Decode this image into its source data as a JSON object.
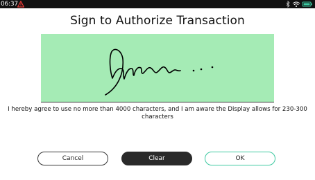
{
  "status_bar": {
    "time": "06:37",
    "icons": [
      "warning-icon",
      "bluetooth-icon",
      "wifi-icon",
      "battery-icon"
    ],
    "warning_color": "#e53935",
    "battery_color": "#3cc8a0"
  },
  "title": "Sign to Authorize Transaction",
  "signature_pad": {
    "background_color": "#a5ebb5"
  },
  "agreement_text": "I hereby agree to use no more than 4000 characters, and I am aware the Display allows for 230-300 characters",
  "buttons": {
    "cancel_label": "Cancel",
    "clear_label": "Clear",
    "ok_label": "OK",
    "ok_border_color": "#3cc8a0"
  }
}
